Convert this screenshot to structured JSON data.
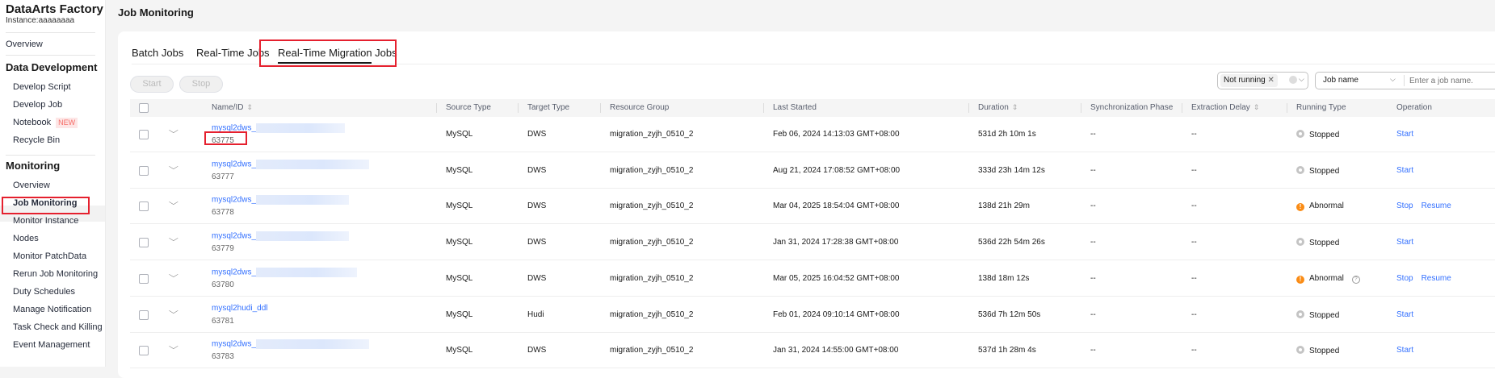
{
  "sidebar": {
    "title": "DataArts Factory",
    "instance": "Instance:aaaaaaaa",
    "overview": "Overview",
    "groups": [
      {
        "label": "Data Development",
        "items": [
          {
            "label": "Develop Script"
          },
          {
            "label": "Develop Job"
          },
          {
            "label": "Notebook",
            "badge": "NEW"
          },
          {
            "label": "Recycle Bin"
          }
        ]
      },
      {
        "label": "Monitoring",
        "items": [
          {
            "label": "Overview"
          },
          {
            "label": "Job Monitoring",
            "active": true
          },
          {
            "label": "Monitor Instance"
          },
          {
            "label": "Nodes"
          },
          {
            "label": "Monitor PatchData"
          },
          {
            "label": "Rerun Job Monitoring"
          },
          {
            "label": "Duty Schedules"
          },
          {
            "label": "Manage Notification"
          },
          {
            "label": "Task Check and Killing"
          },
          {
            "label": "Event Management"
          }
        ]
      }
    ]
  },
  "header": {
    "title": "Job Monitoring"
  },
  "tabs": [
    {
      "label": "Batch Jobs"
    },
    {
      "label": "Real-Time Jobs"
    },
    {
      "label": "Real-Time Migration Jobs",
      "active": true
    }
  ],
  "toolbar": {
    "start": "Start",
    "stop": "Stop",
    "status_filter_chip": "Not running",
    "search_field_select": "Job name",
    "search_placeholder": "Enter a job name."
  },
  "columns": [
    "Name/ID",
    "Source Type",
    "Target Type",
    "Resource Group",
    "Last Started",
    "Duration",
    "Synchronization Phase",
    "Extraction Delay",
    "Running Type",
    "Operation"
  ],
  "rows": [
    {
      "name": "mysql2dws_",
      "id": "63775",
      "source": "MySQL",
      "target": "DWS",
      "group": "migration_zyjh_0510_2",
      "last_started": "Feb 06, 2024 14:13:03 GMT+08:00",
      "duration": "531d 2h 10m 1s",
      "phase": "--",
      "delay": "--",
      "status": "Stopped",
      "ops": [
        "Start"
      ]
    },
    {
      "name": "mysql2dws_",
      "id": "63777",
      "source": "MySQL",
      "target": "DWS",
      "group": "migration_zyjh_0510_2",
      "last_started": "Aug 21, 2024 17:08:52 GMT+08:00",
      "duration": "333d 23h 14m 12s",
      "phase": "--",
      "delay": "--",
      "status": "Stopped",
      "ops": [
        "Start"
      ]
    },
    {
      "name": "mysql2dws_",
      "id": "63778",
      "source": "MySQL",
      "target": "DWS",
      "group": "migration_zyjh_0510_2",
      "last_started": "Mar 04, 2025 18:54:04 GMT+08:00",
      "duration": "138d 21h 29m",
      "phase": "--",
      "delay": "--",
      "status": "Abnormal",
      "ops": [
        "Stop",
        "Resume"
      ]
    },
    {
      "name": "mysql2dws_",
      "id": "63779",
      "source": "MySQL",
      "target": "DWS",
      "group": "migration_zyjh_0510_2",
      "last_started": "Jan 31, 2024 17:28:38 GMT+08:00",
      "duration": "536d 22h 54m 26s",
      "phase": "--",
      "delay": "--",
      "status": "Stopped",
      "ops": [
        "Start"
      ]
    },
    {
      "name": "mysql2dws_",
      "id": "63780",
      "source": "MySQL",
      "target": "DWS",
      "group": "migration_zyjh_0510_2",
      "last_started": "Mar 05, 2025 16:04:52 GMT+08:00",
      "duration": "138d 18m 12s",
      "phase": "--",
      "delay": "--",
      "status": "Abnormal",
      "help": true,
      "ops": [
        "Stop",
        "Resume"
      ]
    },
    {
      "name": "mysql2hudi_ddl",
      "id": "63781",
      "source": "MySQL",
      "target": "Hudi",
      "group": "migration_zyjh_0510_2",
      "last_started": "Feb 01, 2024 09:10:14 GMT+08:00",
      "duration": "536d 7h 12m 50s",
      "phase": "--",
      "delay": "--",
      "status": "Stopped",
      "ops": [
        "Start"
      ]
    },
    {
      "name": "mysql2dws_",
      "id": "63783",
      "source": "MySQL",
      "target": "DWS",
      "group": "migration_zyjh_0510_2",
      "last_started": "Jan 31, 2024 14:55:00 GMT+08:00",
      "duration": "537d 1h 28m 4s",
      "phase": "--",
      "delay": "--",
      "status": "Stopped",
      "ops": [
        "Start"
      ]
    }
  ],
  "colors": {
    "accent": "#3370ff",
    "abnormal": "#fa8c16",
    "highlight": "#e5202e"
  }
}
